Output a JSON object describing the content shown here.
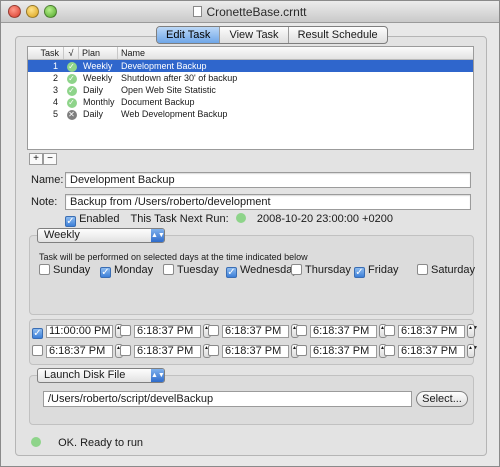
{
  "window": {
    "title": "CronetteBase.crntt"
  },
  "tabs": [
    {
      "label": "Edit Task",
      "active": true
    },
    {
      "label": "View Task",
      "active": false
    },
    {
      "label": "Result Schedule",
      "active": false
    }
  ],
  "table": {
    "headers": {
      "task": "Task",
      "check": "√",
      "plan": "Plan",
      "name": "Name"
    },
    "rows": [
      {
        "task": "1",
        "status": "ok",
        "plan": "Weekly",
        "name": "Development Backup",
        "selected": true
      },
      {
        "task": "2",
        "status": "ok",
        "plan": "Weekly",
        "name": "Shutdown after 30' of backup",
        "selected": false
      },
      {
        "task": "3",
        "status": "ok",
        "plan": "Daily",
        "name": "Open Web Site Statistic",
        "selected": false
      },
      {
        "task": "4",
        "status": "ok",
        "plan": "Monthly",
        "name": "Document Backup",
        "selected": false
      },
      {
        "task": "5",
        "status": "error",
        "plan": "Daily",
        "name": "Web Development Backup",
        "selected": false
      }
    ],
    "add_label": "+",
    "remove_label": "−"
  },
  "form": {
    "name_label": "Name:",
    "name_value": "Development Backup",
    "note_label": "Note:",
    "note_value": "Backup from /Users/roberto/development",
    "enabled_label": "Enabled",
    "enabled": true,
    "next_run_label": "This Task Next Run:",
    "next_run_value": "2008-10-20 23:00:00 +0200"
  },
  "schedule": {
    "plan_value": "Weekly",
    "note": "Task will be performed on selected days at the time indicated below",
    "days": [
      {
        "label": "Sunday",
        "checked": false
      },
      {
        "label": "Monday",
        "checked": true
      },
      {
        "label": "Tuesday",
        "checked": false
      },
      {
        "label": "Wednesday",
        "checked": true
      },
      {
        "label": "Thursday",
        "checked": false
      },
      {
        "label": "Friday",
        "checked": true
      },
      {
        "label": "Saturday",
        "checked": false
      }
    ]
  },
  "times": [
    {
      "value": "11:00:00 PM",
      "checked": true
    },
    {
      "value": "6:18:37 PM",
      "checked": false
    },
    {
      "value": "6:18:37 PM",
      "checked": false
    },
    {
      "value": "6:18:37 PM",
      "checked": false
    },
    {
      "value": "6:18:37 PM",
      "checked": false
    },
    {
      "value": "6:18:37 PM",
      "checked": false
    },
    {
      "value": "6:18:37 PM",
      "checked": false
    },
    {
      "value": "6:18:37 PM",
      "checked": false
    },
    {
      "value": "6:18:37 PM",
      "checked": false
    },
    {
      "value": "6:18:37 PM",
      "checked": false
    }
  ],
  "action": {
    "type_value": "Launch Disk File",
    "path_value": "/Users/roberto/script/develBackup",
    "select_label": "Select..."
  },
  "status": {
    "text": "OK. Ready to run"
  }
}
